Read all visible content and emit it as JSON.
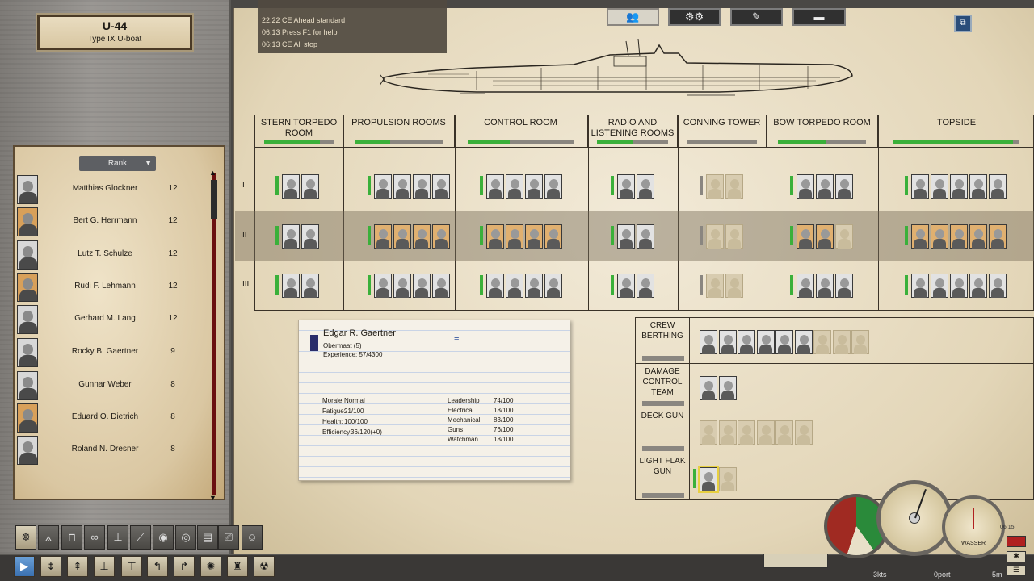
{
  "boat": {
    "name": "U-44",
    "type": "Type IX U-boat"
  },
  "log": [
    "22:22 CE Ahead standard",
    "06:13  Press F1 for help",
    "06:13 CE All stop"
  ],
  "top_tabs": [
    {
      "icon": "crew-icon",
      "glyph": "👥"
    },
    {
      "icon": "gears-icon",
      "glyph": "⚙⚙"
    },
    {
      "icon": "tools-icon",
      "glyph": "✎"
    },
    {
      "icon": "torpedo-icon",
      "glyph": "▬"
    }
  ],
  "roster": {
    "sort_label": "Rank",
    "crew": [
      {
        "name": "Matthias Glockner",
        "level": "12"
      },
      {
        "name": "Bert G. Herrmann",
        "level": "12"
      },
      {
        "name": "Lutz T. Schulze",
        "level": "12"
      },
      {
        "name": "Rudi F. Lehmann",
        "level": "12"
      },
      {
        "name": "Gerhard M. Lang",
        "level": "12"
      },
      {
        "name": "Rocky B. Gaertner",
        "level": "9"
      },
      {
        "name": "Gunnar Weber",
        "level": "8"
      },
      {
        "name": "Eduard O. Dietrich",
        "level": "8"
      },
      {
        "name": "Roland N. Dresner",
        "level": "8"
      }
    ]
  },
  "compartments": [
    {
      "name": "STERN TORPEDO ROOM",
      "level": 0.8
    },
    {
      "name": "PROPULSION ROOMS",
      "level": 0.4
    },
    {
      "name": "CONTROL ROOM",
      "level": 0.4
    },
    {
      "name": "RADIO AND LISTENING ROOMS",
      "level": 0.5
    },
    {
      "name": "CONNING TOWER",
      "level": 0
    },
    {
      "name": "BOW TORPEDO ROOM",
      "level": 0.55
    },
    {
      "name": "TOPSIDE",
      "level": 0.95
    }
  ],
  "shifts": [
    "I",
    "II",
    "III"
  ],
  "crew_card": {
    "name": "Edgar R. Gaertner",
    "rank": "Obermaat (5)",
    "experience": "Experience: 57/4300",
    "stats_left": [
      {
        "label": "Morale:",
        "value": "Normal"
      },
      {
        "label": "Fatigue:",
        "value": "21/100"
      },
      {
        "label": "Health:",
        "value": "100/100"
      },
      {
        "label": "Efficiency:",
        "value": "36/120(+0)"
      }
    ],
    "stats_right": [
      {
        "label": "Leadership",
        "value": "74/100"
      },
      {
        "label": "Electrical",
        "value": "18/100"
      },
      {
        "label": "Mechanical",
        "value": "83/100"
      },
      {
        "label": "Guns",
        "value": "76/100"
      },
      {
        "label": "Watchman",
        "value": "18/100"
      }
    ]
  },
  "stations": [
    {
      "name": "CREW BERTHING"
    },
    {
      "name": "DAMAGE CONTROL TEAM"
    },
    {
      "name": "DECK GUN"
    },
    {
      "name": "LIGHT FLAK GUN"
    }
  ],
  "gauges": {
    "speed": "3kts",
    "order": "0port",
    "depth": "5m",
    "clock": "06:15",
    "depth_label": "WASSER"
  }
}
